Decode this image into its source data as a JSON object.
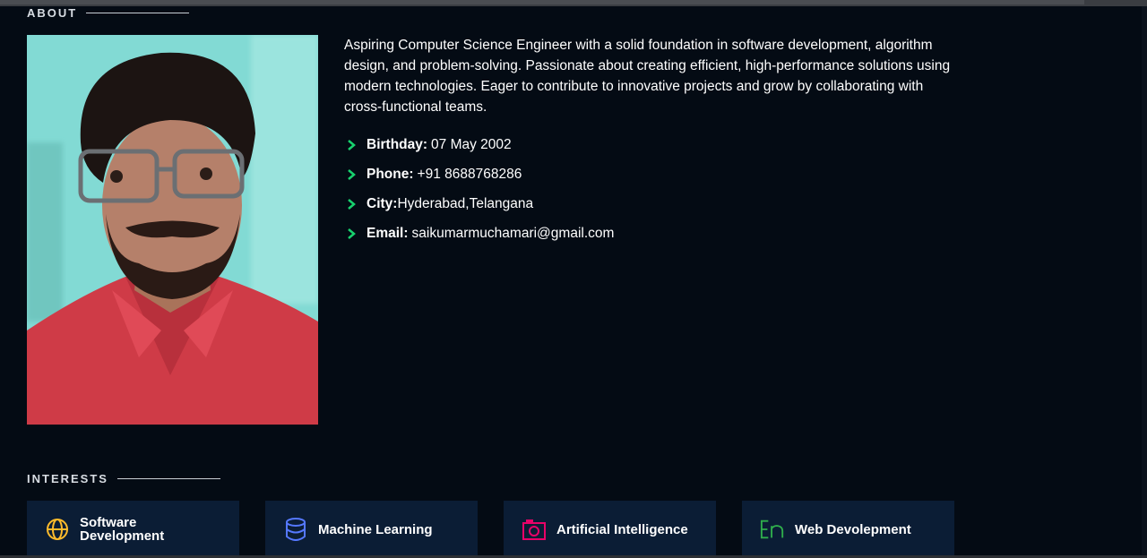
{
  "about": {
    "title": "ABOUT",
    "bio": "Aspiring Computer Science Engineer with a solid foundation in software development, algorithm design, and problem-solving. Passionate about creating efficient, high-performance solutions using modern technologies. Eager to contribute to innovative projects and grow by collaborating with cross-functional teams.",
    "details": [
      {
        "label": "Birthday:",
        "value": " 07 May 2002"
      },
      {
        "label": "Phone:",
        "value": " +91 8688768286"
      },
      {
        "label": "City:",
        "value": "Hyderabad,Telangana"
      },
      {
        "label": "Email:",
        "value": " saikumarmuchamari@gmail.com"
      }
    ],
    "chevron_color": "#18d26e"
  },
  "interests": {
    "title": "INTERESTS",
    "items": [
      {
        "label": "Software Development",
        "icon": "globe-icon",
        "color": "#ffbb2c"
      },
      {
        "label": "Machine Learning",
        "icon": "database-icon",
        "color": "#5578ff"
      },
      {
        "label": "Artificial Intelligence",
        "icon": "camera-icon",
        "color": "#e80368"
      },
      {
        "label": "Web Devolepment",
        "icon": "language-icon",
        "color": "#11dbcf"
      }
    ]
  },
  "colors": {
    "background": "#040b14",
    "card": "#0b1d35"
  }
}
